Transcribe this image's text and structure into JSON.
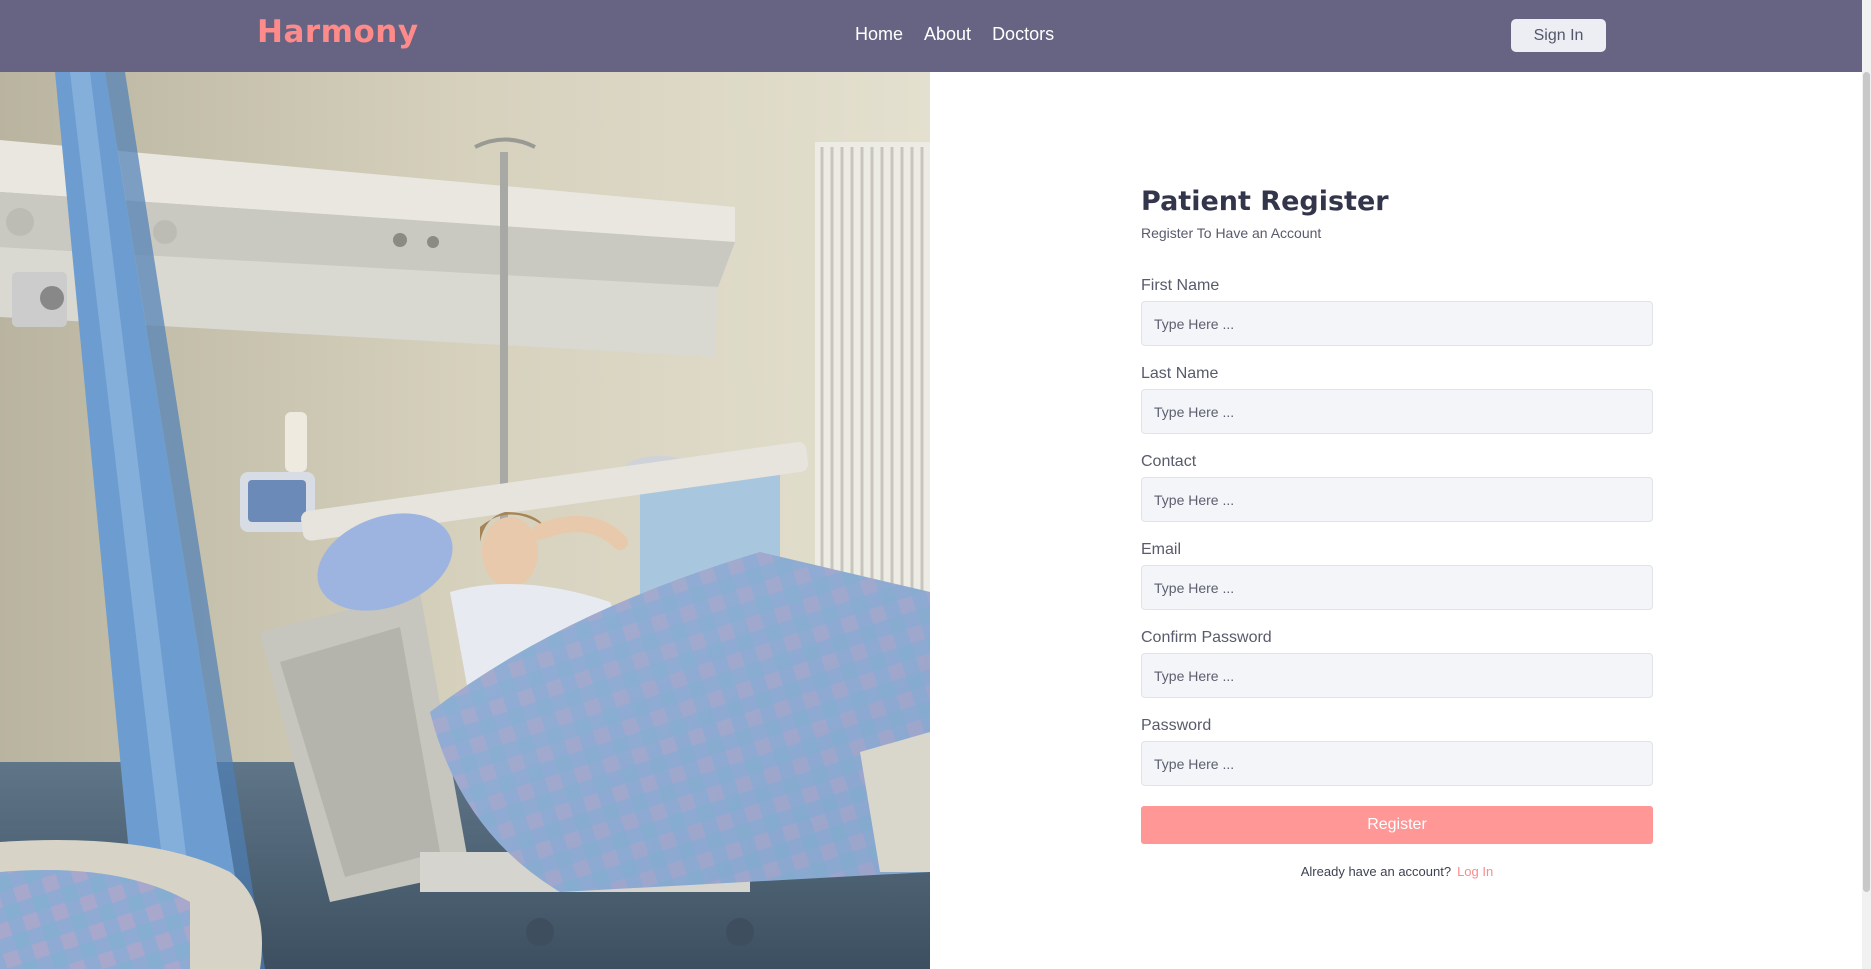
{
  "header": {
    "brand": "Harmony",
    "nav": [
      {
        "label": "Home"
      },
      {
        "label": "About"
      },
      {
        "label": "Doctors"
      }
    ],
    "signin_label": "Sign In"
  },
  "form": {
    "title": "Patient Register",
    "subtitle": "Register To Have an Account",
    "fields": [
      {
        "label": "First Name",
        "placeholder": "Type Here ..."
      },
      {
        "label": "Last Name",
        "placeholder": "Type Here ..."
      },
      {
        "label": "Contact",
        "placeholder": "Type Here ..."
      },
      {
        "label": "Email",
        "placeholder": "Type Here ..."
      },
      {
        "label": "Confirm Password",
        "placeholder": "Type Here ..."
      },
      {
        "label": "Password",
        "placeholder": "Type Here ..."
      }
    ],
    "submit_label": "Register",
    "login_prompt": "Already have an account?",
    "login_link": "Log In"
  },
  "colors": {
    "navbar": "#666482",
    "brand": "#ff8a8a",
    "register_button": "#ff9797",
    "login_link": "#ff8a8a",
    "title": "#33354a"
  }
}
